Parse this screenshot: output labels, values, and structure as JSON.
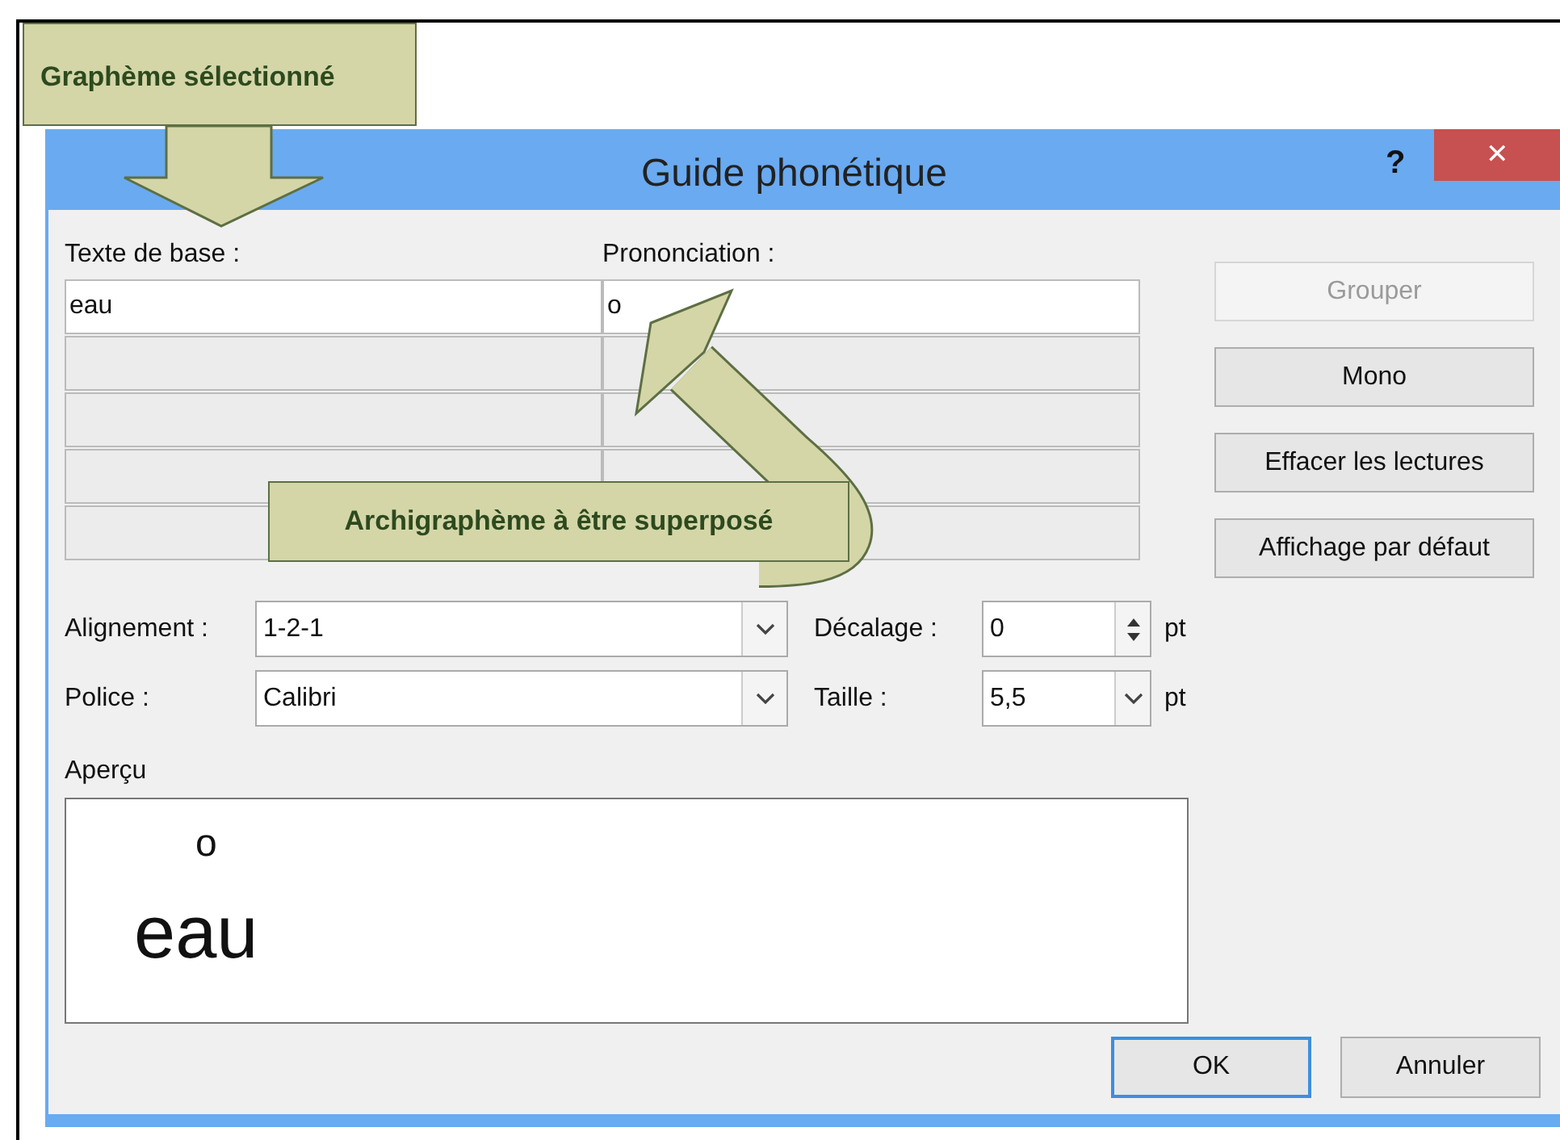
{
  "callout_top": {
    "text": "Graphème sélectionné"
  },
  "callout_curved": {
    "text": "Archigraphème à être superposé"
  },
  "window": {
    "title": "Guide phonétique",
    "help": "?",
    "close": "✕"
  },
  "grid": {
    "headers": [
      "Texte de base :",
      "Prononciation :"
    ],
    "rows": [
      {
        "base_text": "eau",
        "pronunciation": "o",
        "enabled": true
      },
      {
        "enabled": false
      },
      {
        "enabled": false
      },
      {
        "enabled": false
      },
      {
        "enabled": false
      }
    ]
  },
  "side_buttons": [
    {
      "label": "Grouper",
      "disabled": true
    },
    {
      "label": "Mono",
      "disabled": false
    },
    {
      "label": "Effacer les lectures",
      "disabled": false
    },
    {
      "label": "Affichage par défaut",
      "disabled": false
    }
  ],
  "settings": [
    [
      {
        "label": "Alignement :",
        "value": "1-2-1",
        "kind": "combo"
      },
      {
        "label": "Décalage :",
        "value": "0",
        "unit": "pt",
        "kind": "spin"
      }
    ],
    [
      {
        "label": "Police :",
        "value": "Calibri",
        "kind": "combo"
      },
      {
        "label": "Taille :",
        "value": "5,5",
        "unit": "pt",
        "kind": "small-combo"
      }
    ]
  ],
  "preview": {
    "label": "Aperçu",
    "ruby": "o",
    "base": "eau"
  },
  "footer_buttons": [
    {
      "label": "OK",
      "default": true
    },
    {
      "label": "Annuler",
      "default": false
    }
  ]
}
